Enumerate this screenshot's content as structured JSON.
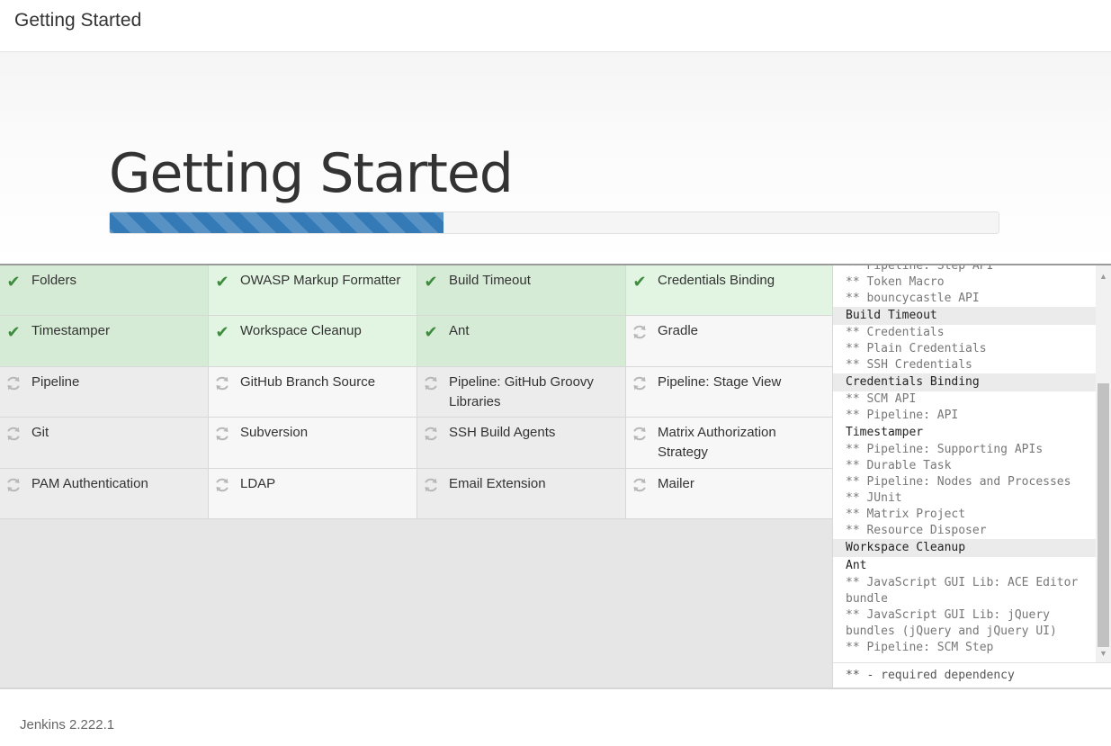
{
  "window": {
    "title": "Getting Started"
  },
  "hero": {
    "title": "Getting Started",
    "progress": 0.375
  },
  "plugins": [
    {
      "name": "Folders",
      "status": "done"
    },
    {
      "name": "OWASP Markup Formatter",
      "status": "done"
    },
    {
      "name": "Build Timeout",
      "status": "done"
    },
    {
      "name": "Credentials Binding",
      "status": "done"
    },
    {
      "name": "Timestamper",
      "status": "done"
    },
    {
      "name": "Workspace Cleanup",
      "status": "done"
    },
    {
      "name": "Ant",
      "status": "done"
    },
    {
      "name": "Gradle",
      "status": "pending"
    },
    {
      "name": "Pipeline",
      "status": "pending"
    },
    {
      "name": "GitHub Branch Source",
      "status": "pending"
    },
    {
      "name": "Pipeline: GitHub Groovy Libraries",
      "status": "pending"
    },
    {
      "name": "Pipeline: Stage View",
      "status": "pending"
    },
    {
      "name": "Git",
      "status": "pending"
    },
    {
      "name": "Subversion",
      "status": "pending"
    },
    {
      "name": "SSH Build Agents",
      "status": "pending"
    },
    {
      "name": "Matrix Authorization Strategy",
      "status": "pending"
    },
    {
      "name": "PAM Authentication",
      "status": "pending"
    },
    {
      "name": "LDAP",
      "status": "pending"
    },
    {
      "name": "Email Extension",
      "status": "pending"
    },
    {
      "name": "Mailer",
      "status": "pending"
    }
  ],
  "log": {
    "lines": [
      {
        "text": "** Pipeline: Step API",
        "kind": "dep"
      },
      {
        "text": "** Token Macro",
        "kind": "dep"
      },
      {
        "text": "** bouncycastle API",
        "kind": "dep"
      },
      {
        "text": "Build Timeout",
        "kind": "plugin",
        "highlight": true
      },
      {
        "text": "** Credentials",
        "kind": "dep"
      },
      {
        "text": "** Plain Credentials",
        "kind": "dep"
      },
      {
        "text": "** SSH Credentials",
        "kind": "dep"
      },
      {
        "text": "Credentials Binding",
        "kind": "plugin",
        "highlight": true
      },
      {
        "text": "** SCM API",
        "kind": "dep"
      },
      {
        "text": "** Pipeline: API",
        "kind": "dep"
      },
      {
        "text": "Timestamper",
        "kind": "plugin",
        "highlight": false
      },
      {
        "text": "** Pipeline: Supporting APIs",
        "kind": "dep"
      },
      {
        "text": "** Durable Task",
        "kind": "dep"
      },
      {
        "text": "** Pipeline: Nodes and Processes",
        "kind": "dep"
      },
      {
        "text": "** JUnit",
        "kind": "dep"
      },
      {
        "text": "** Matrix Project",
        "kind": "dep"
      },
      {
        "text": "** Resource Disposer",
        "kind": "dep"
      },
      {
        "text": "Workspace Cleanup",
        "kind": "plugin",
        "highlight": true
      },
      {
        "text": "Ant",
        "kind": "plugin",
        "highlight": false
      },
      {
        "text": "** JavaScript GUI Lib: ACE Editor bundle",
        "kind": "dep",
        "wrap": true
      },
      {
        "text": "** JavaScript GUI Lib: jQuery bundles (jQuery and jQuery UI)",
        "kind": "dep",
        "wrap": true
      },
      {
        "text": "** Pipeline: SCM Step",
        "kind": "dep"
      }
    ],
    "footer": "** - required dependency"
  },
  "footer": {
    "version": "Jenkins 2.222.1"
  },
  "colors": {
    "accent": "#337ab7",
    "done": "#d6ebd6",
    "check": "#3c8c3c"
  },
  "icons": {
    "done": "check-icon",
    "pending": "refresh-icon"
  }
}
